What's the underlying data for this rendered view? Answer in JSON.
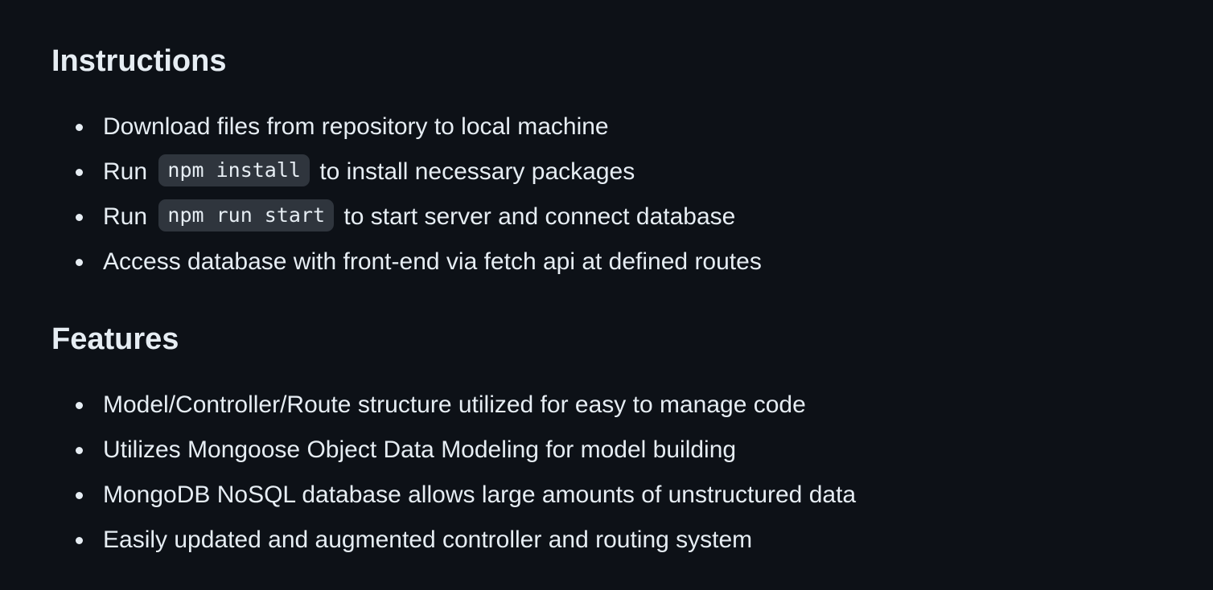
{
  "instructions": {
    "heading": "Instructions",
    "items": [
      {
        "text": "Download files from repository to local machine"
      },
      {
        "before": "Run",
        "code": "npm install",
        "after": "to install necessary packages"
      },
      {
        "before": "Run",
        "code": "npm run start",
        "after": "to start server and connect database"
      },
      {
        "text": "Access database with front-end via fetch api at defined routes"
      }
    ]
  },
  "features": {
    "heading": "Features",
    "items": [
      {
        "text": "Model/Controller/Route structure utilized for easy to manage code"
      },
      {
        "text": "Utilizes Mongoose Object Data Modeling for model building"
      },
      {
        "text": "MongoDB NoSQL database allows large amounts of unstructured data"
      },
      {
        "text": "Easily updated and augmented controller and routing system"
      }
    ]
  },
  "colors": {
    "background": "#0d1117",
    "text": "#e6edf3",
    "code_background": "#2f353d"
  }
}
